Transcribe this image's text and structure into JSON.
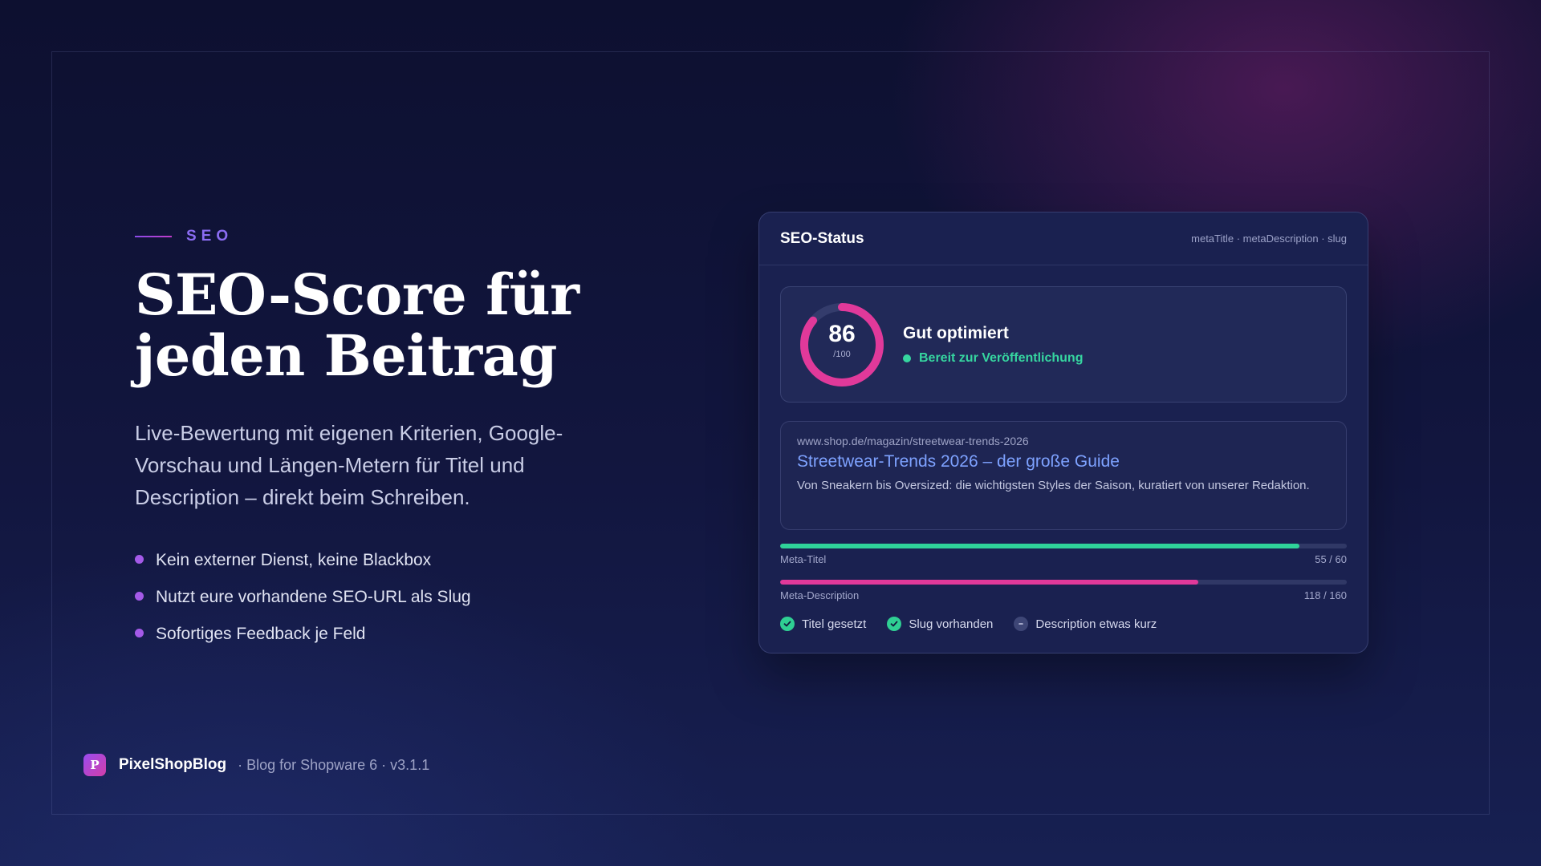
{
  "colors": {
    "accent_purple": "#8b6cf2",
    "accent_pink": "#e0399a",
    "success_green": "#2fd39a",
    "link_blue": "#7ea2ff",
    "background": "#12163f"
  },
  "hero": {
    "eyebrow": "SEO",
    "headline_line1": "SEO-Score für",
    "headline_line2": "jeden Beitrag",
    "subline": "Live-Bewertung mit eigenen Kriterien, Google-Vorschau und Längen-Metern für Titel und Description – direkt beim Schreiben.",
    "bullets": [
      "Kein externer Dienst, keine Blackbox",
      "Nutzt eure vorhandene SEO-URL als Slug",
      "Sofortiges Feedback je Feld"
    ]
  },
  "brand": {
    "logo_letter": "P",
    "name": "PixelShopBlog",
    "meta": "· Blog for Shopware 6 · v3.1.1"
  },
  "card": {
    "title": "SEO-Status",
    "fields": "metaTitle · metaDescription · slug",
    "score": {
      "value": "86",
      "max": "/100",
      "fraction": 0.86,
      "label": "Gut optimiert",
      "status": "Bereit zur Veröffentlichung"
    },
    "preview": {
      "url": "www.shop.de/magazin/streetwear-trends-2026",
      "title": "Streetwear-Trends 2026 – der große Guide",
      "description": "Von Sneakern bis Oversized: die wichtigsten Styles der Saison, kuratiert von unserer Redaktion."
    },
    "meters": [
      {
        "label": "Meta-Titel",
        "count": "55 / 60",
        "fraction": 0.917,
        "color": "#2fd39a"
      },
      {
        "label": "Meta-Description",
        "count": "118 / 160",
        "fraction": 0.7375,
        "color": "#e0399a"
      }
    ],
    "checks": [
      {
        "label": "Titel gesetzt",
        "state": "ok",
        "icon": "check-icon"
      },
      {
        "label": "Slug vorhanden",
        "state": "ok",
        "icon": "check-icon"
      },
      {
        "label": "Description etwas kurz",
        "state": "warn",
        "icon": "minus-icon"
      }
    ]
  }
}
